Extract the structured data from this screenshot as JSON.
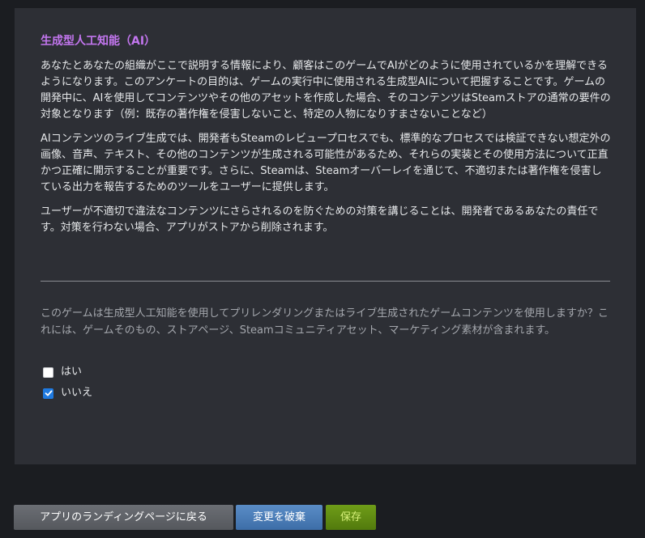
{
  "section": {
    "title": "生成型人工知能（AI）",
    "paragraphs": [
      "あなたとあなたの組織がここで説明する情報により、顧客はこのゲームでAIがどのように使用されているかを理解できるようになります。このアンケートの目的は、ゲームの実行中に使用される生成型AIについて把握することです。ゲームの開発中に、AIを使用してコンテンツやその他のアセットを作成した場合、そのコンテンツはSteamストアの通常の要件の対象となります（例：既存の著作権を侵害しないこと、特定の人物になりすまさないことなど）",
      "AIコンテンツのライブ生成では、開発者もSteamのレビュープロセスでも、標準的なプロセスでは検証できない想定外の画像、音声、テキスト、その他のコンテンツが生成される可能性があるため、それらの実装とその使用方法について正直かつ正確に開示することが重要です。さらに、Steamは、Steamオーバーレイを通じて、不適切または著作権を侵害している出力を報告するためのツールをユーザーに提供します。",
      "ユーザーが不適切で違法なコンテンツにさらされるのを防ぐための対策を講じることは、開発者であるあなたの責任です。対策を行わない場合、アプリがストアから削除されます。"
    ]
  },
  "question": {
    "text": "このゲームは生成型人工知能を使用してプリレンダリングまたはライブ生成されたゲームコンテンツを使用しますか？これには、ゲームそのもの、ストアページ、Steamコミュニティアセット、マーケティング素材が含まれます。",
    "options": [
      {
        "label": "はい",
        "checked": false
      },
      {
        "label": "いいえ",
        "checked": true
      }
    ]
  },
  "buttons": {
    "back_label": "アプリのランディングページに戻る",
    "discard_label": "変更を破棄",
    "save_label": "保存"
  },
  "colors": {
    "accent_title": "#c376ef",
    "checkbox_checked": "#1f7ae0",
    "button_back": "#5f6268",
    "button_discard": "#4a7db8",
    "button_save": "#608c12"
  }
}
